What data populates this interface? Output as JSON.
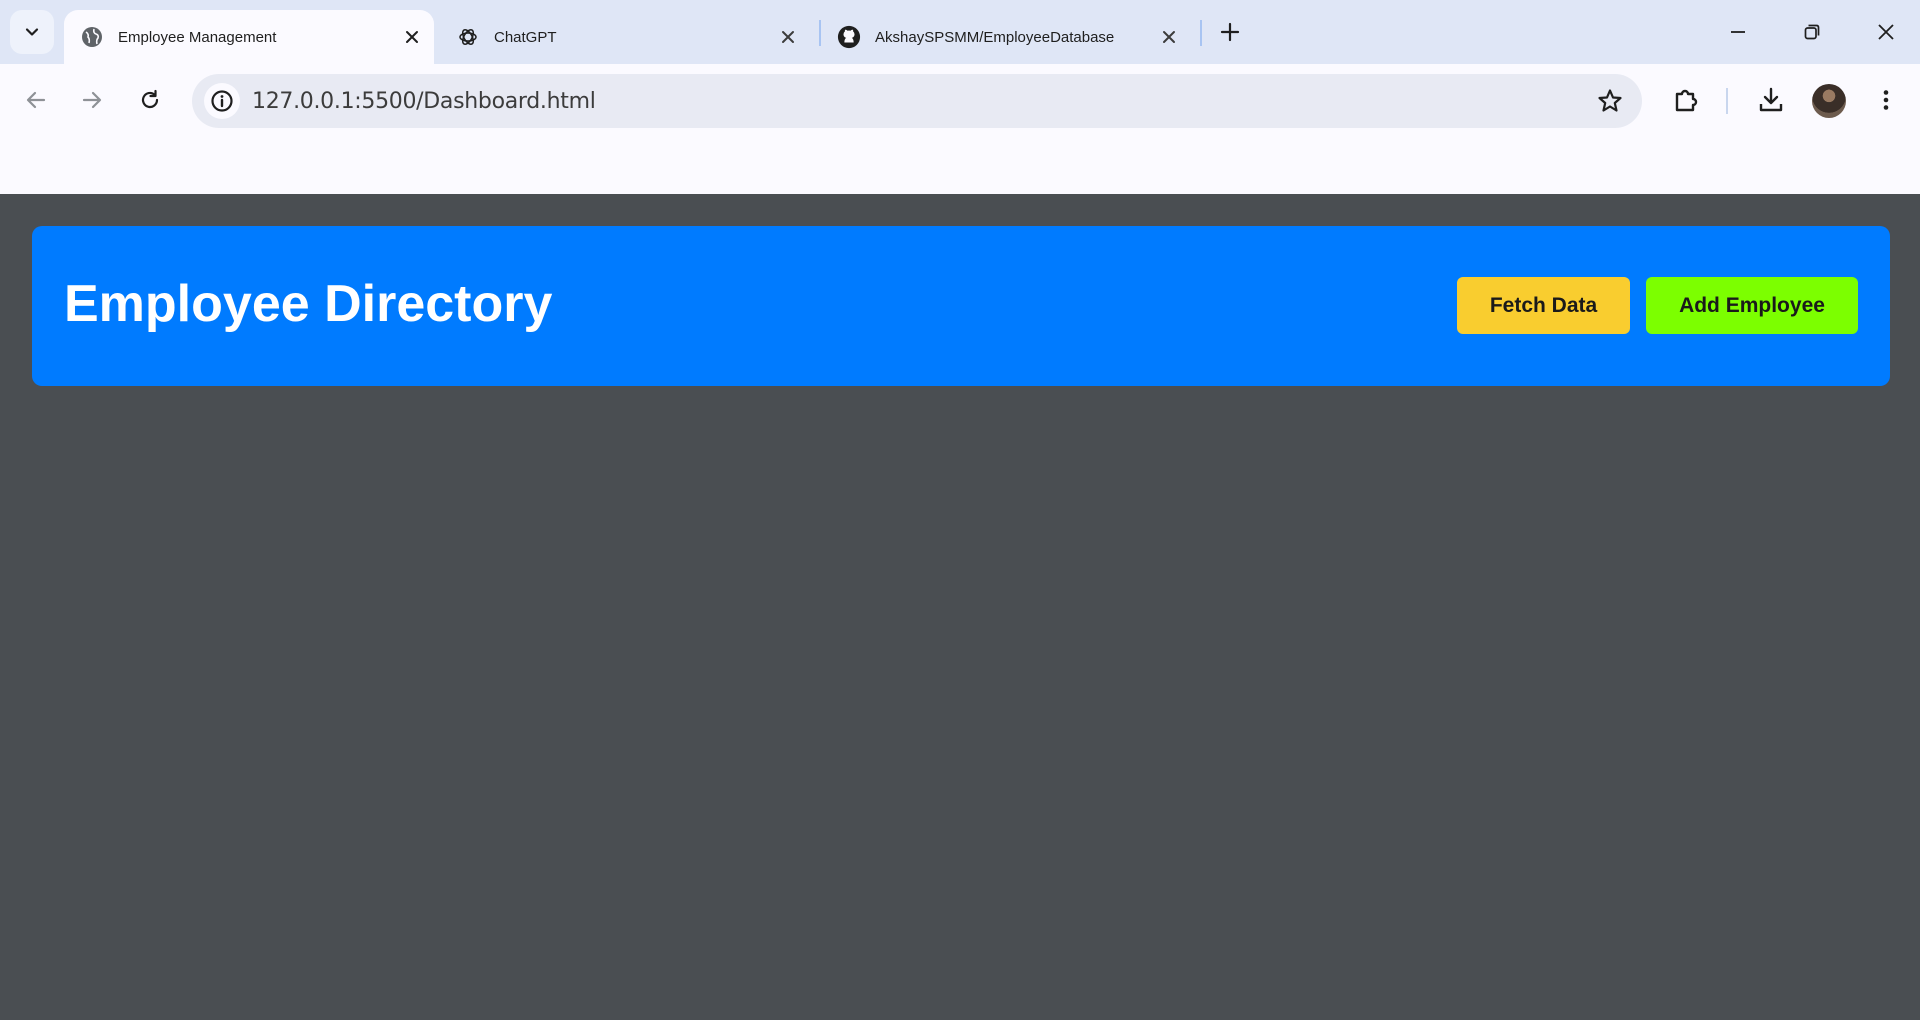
{
  "browser": {
    "tabs": [
      {
        "title": "Employee Management",
        "icon": "globe-icon",
        "active": true
      },
      {
        "title": "ChatGPT",
        "icon": "chatgpt-icon",
        "active": false
      },
      {
        "title": "AkshaySPSMM/EmployeeDatabase",
        "icon": "github-icon",
        "active": false
      }
    ],
    "address": "127.0.0.1:5500/Dashboard.html"
  },
  "page": {
    "title": "Employee Directory",
    "buttons": {
      "fetch": "Fetch Data",
      "add": "Add Employee"
    }
  },
  "colors": {
    "header_bg": "#007bff",
    "fetch_bg": "#f9cd2f",
    "add_bg": "#7cff00",
    "page_bg": "#4a4e52"
  }
}
